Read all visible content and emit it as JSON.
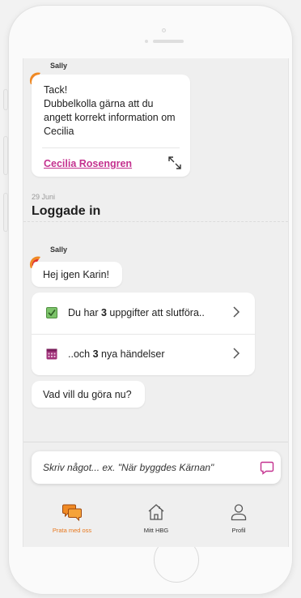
{
  "chat": {
    "messages": [
      {
        "sender": "Sally",
        "text": "Tack!\nDubbelkolla gärna att du angett korrekt information om Cecilia",
        "link_label": "Cecilia Rosengren"
      }
    ],
    "divider": {
      "date": "29 Juni",
      "title": "Loggade in"
    },
    "session": {
      "sender": "Sally",
      "greeting": "Hej igen Karin!",
      "actions": [
        {
          "pre": "Du har ",
          "count": "3",
          "post": " uppgifter att slutföra..",
          "icon": "checkbox-icon"
        },
        {
          "pre": "..och ",
          "count": "3",
          "post": " nya händelser",
          "icon": "calendar-icon"
        }
      ],
      "prompt": "Vad vill du göra nu?"
    }
  },
  "composer": {
    "placeholder": "Skriv något... ex. \"När byggdes Kärnan\"",
    "send_icon": "chat-bubble-icon"
  },
  "tabs": [
    {
      "label": "Prata med oss",
      "icon": "chat-bubbles-icon",
      "active": true
    },
    {
      "label": "Mitt HBG",
      "icon": "home-icon",
      "active": false
    },
    {
      "label": "Profil",
      "icon": "user-icon",
      "active": false
    }
  ],
  "colors": {
    "accent": "#e8781e",
    "link": "#c4318f",
    "avatar_orange": "#f08a24",
    "avatar_red": "#e0312b",
    "checkbox_green": "#7cc36a",
    "calendar_purple": "#a0327a"
  }
}
